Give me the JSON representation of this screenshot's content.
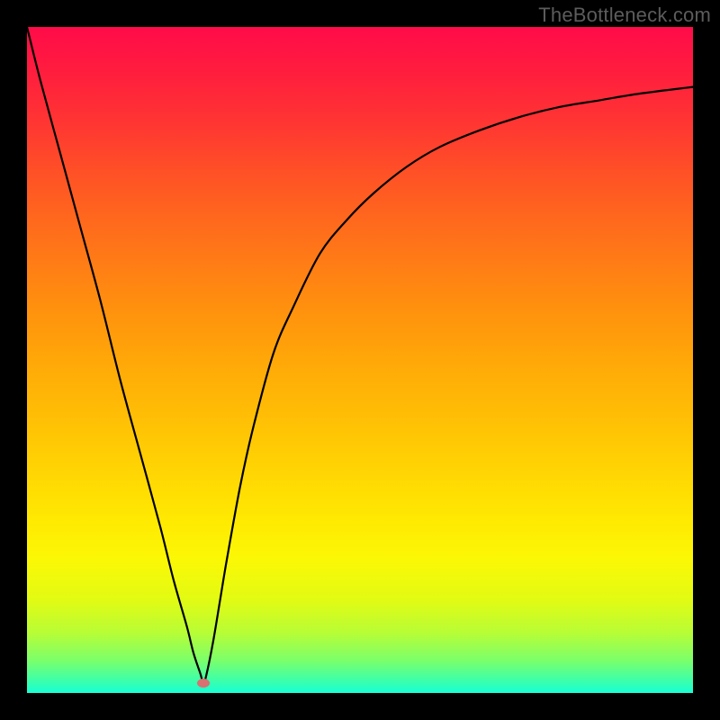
{
  "watermark": "TheBottleneck.com",
  "chart_data": {
    "type": "line",
    "title": "",
    "xlabel": "",
    "ylabel": "",
    "xlim": [
      0,
      100
    ],
    "ylim": [
      0,
      100
    ],
    "grid": false,
    "legend": false,
    "marker": {
      "x": 26.5,
      "y": 1.5
    },
    "series": [
      {
        "name": "curve",
        "x": [
          0,
          2,
          5,
          8,
          11,
          14,
          17,
          20,
          22,
          24,
          25,
          26,
          26.5,
          27,
          28,
          29,
          30,
          32,
          34,
          37,
          40,
          44,
          48,
          52,
          57,
          62,
          68,
          74,
          80,
          86,
          92,
          100
        ],
        "y": [
          100,
          92,
          81,
          70,
          59,
          47,
          36,
          25,
          17,
          10,
          6,
          3,
          1.5,
          3,
          8,
          14,
          20,
          31,
          40,
          51,
          58,
          66,
          71,
          75,
          79,
          82,
          84.5,
          86.5,
          88,
          89,
          90,
          91
        ]
      }
    ],
    "background_gradient_note": "red (top) to green (bottom) heat gradient"
  }
}
